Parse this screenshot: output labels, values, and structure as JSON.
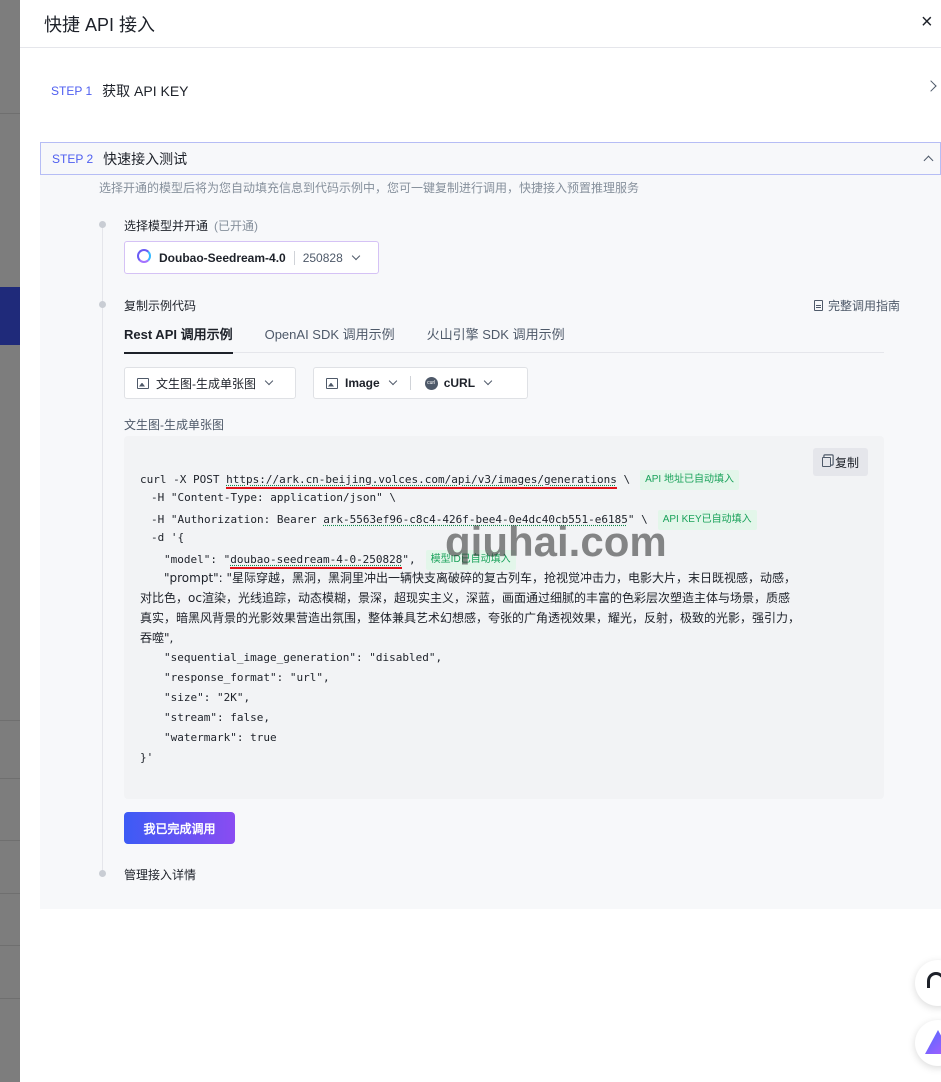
{
  "drawer": {
    "title": "快捷 API 接入",
    "close": "×"
  },
  "step1": {
    "num": "STEP 1",
    "label": "获取 API KEY"
  },
  "step2": {
    "num": "STEP 2",
    "label": "快速接入测试",
    "desc": "选择开通的模型后将为您自动填充信息到代码示例中，您可一键复制进行调用，快捷接入预置推理服务",
    "select_model_title": "选择模型并开通",
    "select_model_status": "(已开通)",
    "model": {
      "name": "Doubao-Seedream-4.0",
      "version": "250828"
    },
    "copy_code_title": "复制示例代码",
    "guide_link": "完整调用指南",
    "tabs": [
      "Rest API 调用示例",
      "OpenAI SDK 调用示例",
      "火山引擎 SDK 调用示例"
    ],
    "scene_select": "文生图-生成单张图",
    "type_select": "Image",
    "lang_select": "cURL",
    "code_title": "文生图-生成单张图",
    "copy_label": "复制",
    "code": {
      "l1_prefix": "curl -X POST ",
      "l1_url": "https://ark.cn-beijing.volces.com/api/v3/images/generations",
      "l1_suffix": " \\",
      "badge_api": "API 地址已自动填入",
      "l2": "-H \"Content-Type: application/json\" \\",
      "l3_prefix": "-H \"Authorization: Bearer ",
      "l3_key": "ark-5563ef96-c8c4-426f-bee4-0e4dc40cb551-e6185",
      "l3_suffix": "\" \\",
      "badge_key": "API KEY已自动填入",
      "l4": "-d '{",
      "l5_prefix": "\"model\": \"",
      "l5_model": "doubao-seedream-4-0-250828",
      "l5_suffix": "\",",
      "badge_model": "模型ID已自动填入",
      "l6_prompt": "\"prompt\": \"星际穿越，黑洞，黑洞里冲出一辆快支离破碎的复古列车，抢视觉冲击力，电影大片，末日既视感，动感，对比色，oc渲染，光线追踪，动态模糊，景深，超现实主义，深蓝，画面通过细腻的丰富的色彩层次塑造主体与场景，质感真实，暗黑风背景的光影效果营造出氛围，整体兼具艺术幻想感，夸张的广角透视效果，耀光，反射，极致的光影，强引力，吞噬\",",
      "l7": "\"sequential_image_generation\": \"disabled\",",
      "l8": "\"response_format\": \"url\",",
      "l9": "\"size\": \"2K\",",
      "l10": "\"stream\": false,",
      "l11": "\"watermark\": true",
      "l12": "}'"
    },
    "done_button": "我已完成调用",
    "manage_title": "管理接入详情"
  },
  "watermark": "qiuhai.com",
  "icons": {
    "close": "close-icon",
    "chevron": "chevron-icon",
    "doc": "doc-icon",
    "image": "image-icon",
    "curl": "curl-icon",
    "copy": "copy-icon",
    "support": "headset-icon",
    "assistant": "sparkle-icon"
  },
  "colors": {
    "accent": "#4e5ef0",
    "badge": "#1aa25b",
    "underline": "#e0121a"
  }
}
